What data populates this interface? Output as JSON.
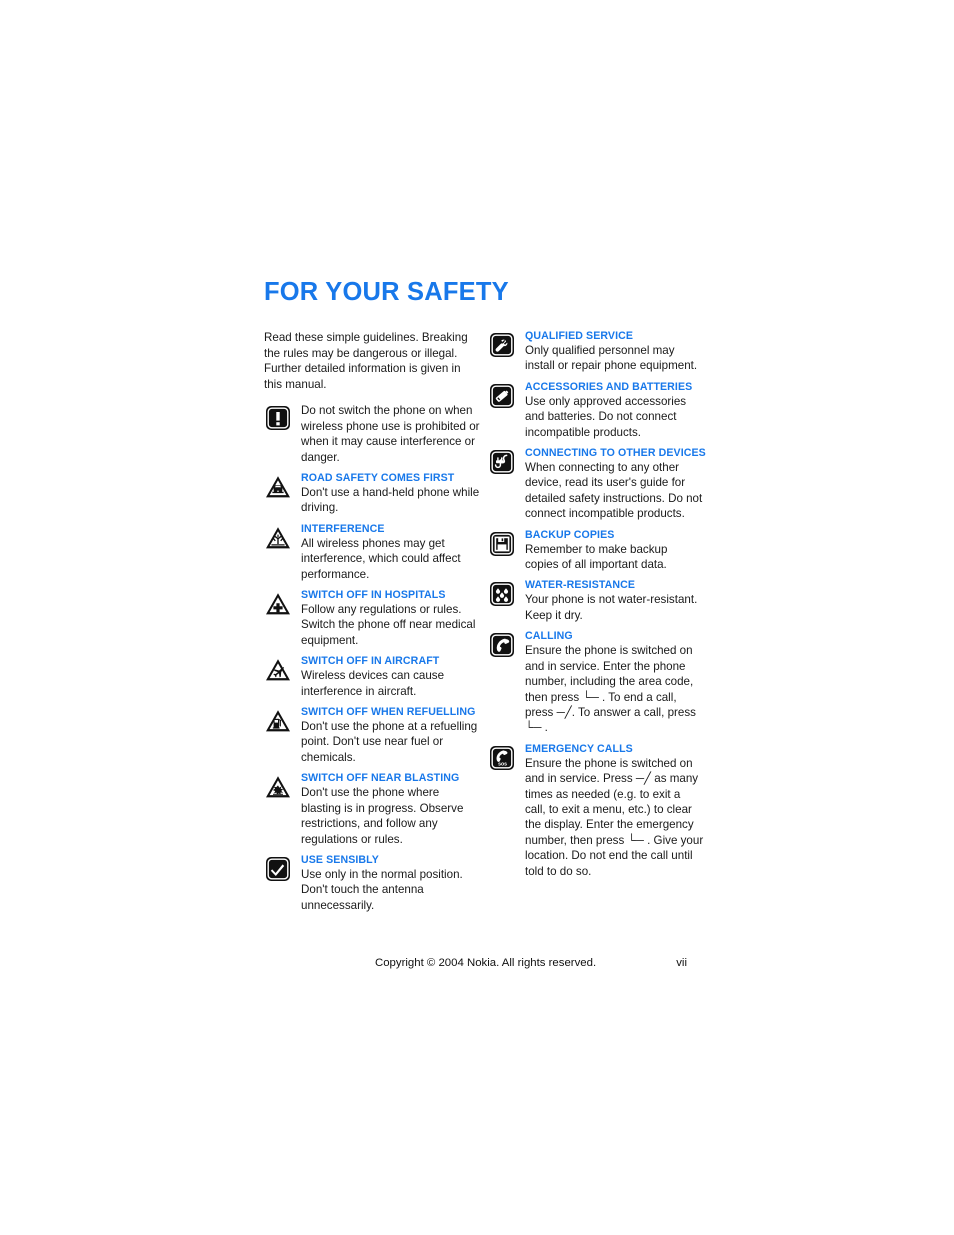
{
  "document": {
    "title": "FOR YOUR SAFETY",
    "accent_color": "#1878ea",
    "text_color": "#1a1a1a"
  },
  "intro": {
    "text": "Read these simple guidelines. Breaking the rules may be dangerous or illegal. Further detailed information is given in this manual."
  },
  "left_column": {
    "entries": [
      {
        "icon": "exclamation-square-icon",
        "heading": "",
        "text": "Do not switch the phone on when wireless phone use is prohibited or when it may cause interference or danger."
      },
      {
        "icon": "road-safety-triangle-icon",
        "heading": "ROAD SAFETY COMES FIRST",
        "text": "Don't use a hand-held phone while driving."
      },
      {
        "icon": "interference-triangle-icon",
        "heading": "INTERFERENCE",
        "text": "All wireless phones may get interference, which could affect performance."
      },
      {
        "icon": "hospital-triangle-icon",
        "heading": "SWITCH OFF IN HOSPITALS",
        "text": "Follow any regulations or rules. Switch the phone off near medical equipment."
      },
      {
        "icon": "aircraft-triangle-icon",
        "heading": "SWITCH OFF IN AIRCRAFT",
        "text": "Wireless devices can cause interference in aircraft."
      },
      {
        "icon": "refuelling-triangle-icon",
        "heading": "SWITCH OFF WHEN REFUELLING",
        "text": "Don't use the phone at a refuelling point. Don't use near fuel or chemicals."
      },
      {
        "icon": "blasting-triangle-icon",
        "heading": "SWITCH OFF NEAR BLASTING",
        "text": "Don't use the phone where blasting is in progress. Observe restrictions, and follow any regulations or rules."
      },
      {
        "icon": "checkmark-square-icon",
        "heading": "USE SENSIBLY",
        "text": "Use only in the normal position. Don't touch the antenna unnecessarily."
      }
    ]
  },
  "right_column": {
    "entries": [
      {
        "icon": "wrench-square-icon",
        "heading": "QUALIFIED SERVICE",
        "text": "Only qualified personnel may install or repair phone equipment."
      },
      {
        "icon": "battery-square-icon",
        "heading": "ACCESSORIES AND BATTERIES",
        "text": "Use only approved accessories and batteries. Do not connect incompatible products."
      },
      {
        "icon": "plug-cable-square-icon",
        "heading": "CONNECTING TO OTHER DEVICES",
        "text": "When connecting to any other device, read its user's guide for detailed safety instructions. Do not connect incompatible products."
      },
      {
        "icon": "floppy-disk-square-icon",
        "heading": "BACKUP COPIES",
        "text": "Remember to make backup copies of all important data."
      },
      {
        "icon": "water-drops-square-icon",
        "heading": "WATER-RESISTANCE",
        "text": "Your phone is not water-resistant. Keep it dry."
      },
      {
        "icon": "phone-handset-square-icon",
        "heading": "CALLING",
        "text": "Ensure the phone is switched on and in service. Enter the phone number, including the area code, then press └─ . To end a call, press ─╱. To answer a call, press └─ ."
      },
      {
        "icon": "emergency-sos-square-icon",
        "heading": "EMERGENCY CALLS",
        "text": "Ensure the phone is switched on and in service. Press ─╱ as many times as needed (e.g. to exit a call, to exit a menu, etc.) to clear the display. Enter the emergency number, then press └─ . Give your location. Do not end the call until told to do so."
      }
    ]
  },
  "footer": {
    "copyright": "Copyright © 2004 Nokia. All rights reserved.",
    "page_number": "vii"
  }
}
